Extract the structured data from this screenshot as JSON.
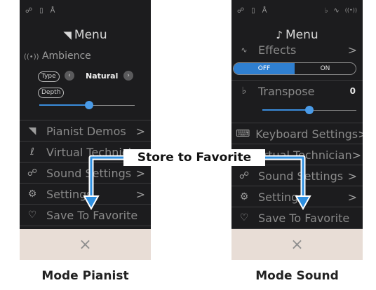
{
  "callout": {
    "label": "Store to Favorite"
  },
  "captions": {
    "left": "Mode Pianist",
    "right": "Mode Sound"
  },
  "colors": {
    "accent": "#3a8cdb",
    "footer": "#e8ddd6",
    "panel": "#1c1c1e"
  },
  "left_screen": {
    "status_icons": [
      "headphones-icon",
      "usb-icon",
      "bluetooth-icon"
    ],
    "title": "Menu",
    "ambience": {
      "label": "Ambience",
      "type_label": "Type",
      "value": "Natural",
      "depth_label": "Depth",
      "depth_level": 0.52
    },
    "items": [
      {
        "icon": "piano-icon",
        "label": "Pianist Demos",
        "chevron": ">"
      },
      {
        "icon": "technician-icon",
        "label": "Virtual Technician",
        "chevron": ""
      },
      {
        "icon": "headphones-icon",
        "label": "Sound Settings",
        "chevron": ">"
      },
      {
        "icon": "gear-icon",
        "label": "Settings",
        "chevron": ">"
      },
      {
        "icon": "heart-icon",
        "label": "Save To Favorite",
        "chevron": ""
      }
    ],
    "close": "×"
  },
  "right_screen": {
    "status_icons": [
      "headphones-icon",
      "usb-icon",
      "bluetooth-icon",
      "metronome-icon",
      "effects-icon",
      "ambience-icon"
    ],
    "title": "Menu",
    "effects": {
      "label": "Effects",
      "chevron": ">",
      "off": "OFF",
      "on": "ON"
    },
    "transpose": {
      "label": "Transpose",
      "value": "0",
      "level": 0.5
    },
    "items": [
      {
        "icon": "keyboard-icon",
        "label": "Keyboard Settings",
        "chevron": ">"
      },
      {
        "icon": "technician-icon",
        "label": "Virtual Technician",
        "chevron": ">"
      },
      {
        "icon": "headphones-icon",
        "label": "Sound Settings",
        "chevron": ">"
      },
      {
        "icon": "gear-icon",
        "label": "Settings",
        "chevron": ">"
      },
      {
        "icon": "heart-icon",
        "label": "Save To Favorite",
        "chevron": ""
      }
    ],
    "close": "×"
  }
}
